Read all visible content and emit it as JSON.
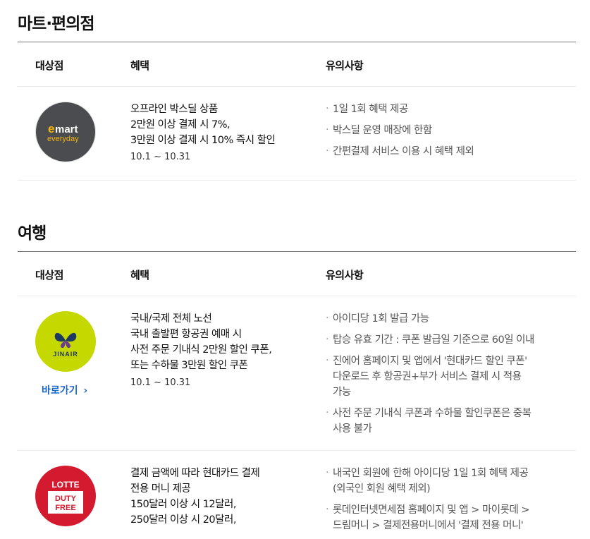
{
  "sections": [
    {
      "title": "마트·편의점",
      "headers": [
        "대상점",
        "혜택",
        "유의사항"
      ],
      "rows": [
        {
          "logo": {
            "name": "emart everyday",
            "text1": "emart",
            "text2": "everyday",
            "bg": "#4a4c4f",
            "accent": "#f6b40e"
          },
          "benefit_lines": [
            "오프라인 박스딜 상품",
            "2만원 이상 결제 시 7%,",
            "3만원 이상 결제 시 10% 즉시 할인"
          ],
          "period": "10.1 ~ 10.31",
          "notes": [
            "1일 1회 혜택 제공",
            "박스딜 운영 매장에 한함",
            "간편결제 서비스 이용 시 혜택 제외"
          ]
        }
      ]
    },
    {
      "title": "여행",
      "headers": [
        "대상점",
        "혜택",
        "유의사항"
      ],
      "rows": [
        {
          "logo": {
            "name": "JINAIR",
            "text1": "JINAIR",
            "bg": "#c5d800"
          },
          "link": "바로가기",
          "benefit_lines": [
            "국내/국제 전체 노선",
            "국내 출발편 항공권 예매 시",
            "사전 주문 기내식 2만원 할인 쿠폰,",
            "또는 수하물 3만원 할인 쿠폰"
          ],
          "period": "10.1 ~ 10.31",
          "notes": [
            [
              "아이디당 1회 발급 가능"
            ],
            [
              "탑승 유효 기간 : 쿠폰 발급일 기준으로 60일 이내"
            ],
            [
              "진에어 홈페이지 및 앱에서 '현대카드 할인 쿠폰'",
              "다운로드 후 항공권+부가 서비스 결제 시 적용",
              "가능"
            ],
            [
              "사전 주문 기내식 쿠폰과 수하물 할인쿠폰은 중복",
              "사용 불가"
            ]
          ]
        },
        {
          "logo": {
            "name": "LOTTE DUTY FREE",
            "text1": "LOTTE",
            "text2": "DUTY",
            "text3": "FREE",
            "bg": "#d31a2f"
          },
          "benefit_lines": [
            "결제 금액에 따라 현대카드 결제",
            "전용 머니 제공",
            "150달러 이상 시 12달러,",
            "250달러 이상 시 20달러,"
          ],
          "notes": [
            [
              "내국인 회원에 한해 아이디당 1일 1회 혜택 제공",
              "(외국인 회원 혜택 제외)"
            ],
            [
              "롯데인터넷면세점 홈페이지 및 앱 > 마이롯데 >",
              "드림머니 > 결제전용머니에서 '결제 전용 머니'"
            ]
          ]
        }
      ]
    }
  ],
  "colors": {
    "link": "#1c66c9",
    "divider_dark": "#777777",
    "divider_light": "#ebebeb"
  }
}
